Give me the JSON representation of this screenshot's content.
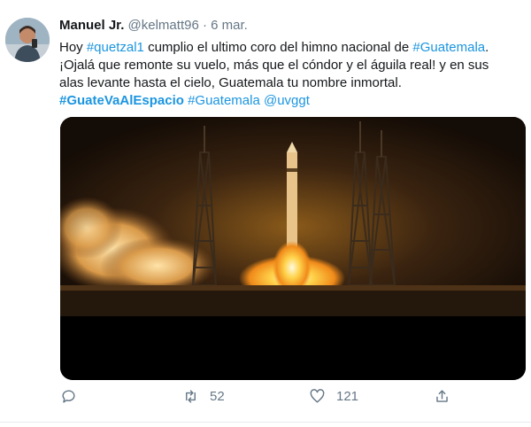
{
  "tweet": {
    "author_name": "Manuel Jr.",
    "handle": "@kelmatt96",
    "separator": "·",
    "date": "6 mar.",
    "text": {
      "line1_pre": "Hoy ",
      "hashtag_quetzal": "#quetzal1",
      "line1_mid": " cumplio el ultimo coro del himno nacional de ",
      "hashtag_guatemala": "#Guatemala",
      "line1_end": ".",
      "line2": "¡Ojalá que remonte su vuelo, más que el cóndor y el águila real! y en sus",
      "line3": "alas levante hasta el cielo, Guatemala  tu nombre inmortal.",
      "tag1": "#GuateVaAlEspacio",
      "tag2": "#Guatemala",
      "mention": "@uvggt"
    },
    "actions": {
      "retweets": "52",
      "likes": "121"
    }
  },
  "colors": {
    "link": "#1b95e0",
    "text": "#14171a",
    "muted": "#657786"
  }
}
